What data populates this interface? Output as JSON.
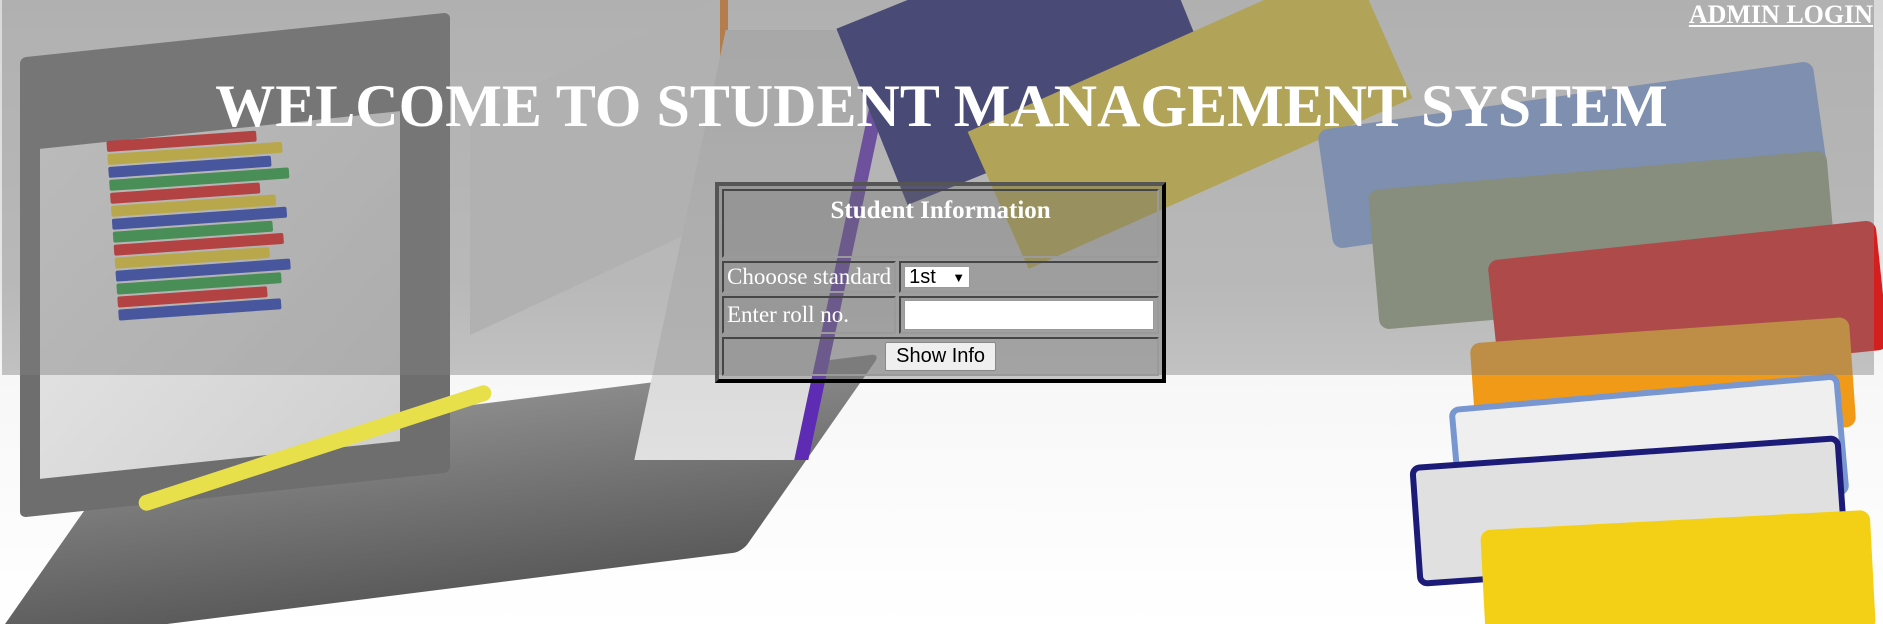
{
  "header": {
    "admin_link": "ADMIN LOGIN",
    "title": "WELCOME TO STUDENT MANAGEMENT SYSTEM"
  },
  "form": {
    "heading": "Student Information",
    "standard_label": "Chooose standard",
    "standard_selected": "1st",
    "roll_label": "Enter roll no.",
    "roll_value": "",
    "submit_label": "Show Info"
  },
  "icons": {
    "select_arrow": "chevron-down-icon"
  },
  "colors": {
    "text": "#ffffff",
    "band": "rgba(128,128,128,0.45)"
  }
}
